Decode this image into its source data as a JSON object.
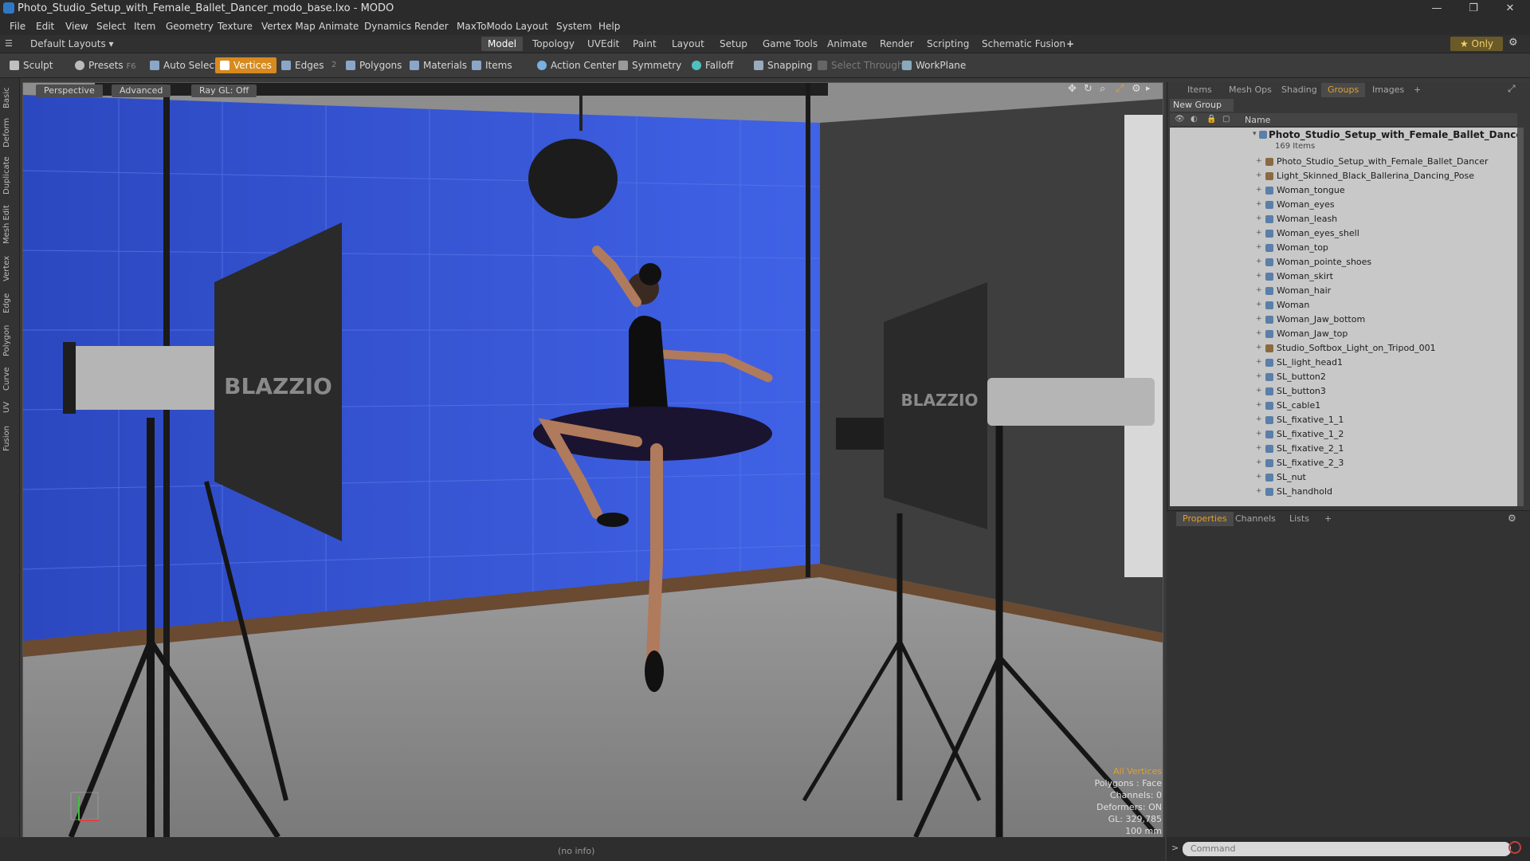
{
  "window": {
    "title": "Photo_Studio_Setup_with_Female_Ballet_Dancer_modo_base.lxo - MODO"
  },
  "menu": [
    "File",
    "Edit",
    "View",
    "Select",
    "Item",
    "Geometry",
    "Texture",
    "Vertex Map",
    "Animate",
    "Dynamics",
    "Render",
    "MaxToModo",
    "Layout",
    "System",
    "Help"
  ],
  "layout_bar": {
    "preset": "Default Layouts ▾",
    "tabs": [
      "Model",
      "Topology",
      "UVEdit",
      "Paint",
      "Layout",
      "Setup",
      "Game Tools",
      "Animate",
      "Render",
      "Scripting",
      "Schematic Fusion"
    ],
    "active_tab": "Model",
    "only_label": "★ Only"
  },
  "toolbar": {
    "sculpt": "Sculpt",
    "presets": "Presets",
    "presets_key": "F6",
    "auto_select": "Auto Select",
    "vertices": "Vertices",
    "edges": "Edges",
    "edges_count": "2",
    "polygons": "Polygons",
    "materials": "Materials",
    "items": "Items",
    "action_center": "Action Center",
    "symmetry": "Symmetry",
    "falloff": "Falloff",
    "snapping": "Snapping",
    "select_through": "Select Through",
    "workplane": "WorkPlane"
  },
  "left_tabs": [
    "Basic",
    "Deform",
    "Duplicate",
    "Mesh Edit",
    "Vertex",
    "Edge",
    "Polygon",
    "Curve",
    "UV",
    "Fusion"
  ],
  "viewport": {
    "tabs": [
      "Perspective",
      "Advanced",
      "Ray GL: Off"
    ],
    "softbox_brand": "BLAZZIO",
    "readout": {
      "mode": "All Vertices",
      "polygons": "Polygons : Face",
      "channels": "Channels: 0",
      "deformers": "Deformers: ON",
      "gl": "GL: 329,785",
      "scale": "100 mm"
    }
  },
  "status": {
    "info": "(no info)"
  },
  "right_panel": {
    "tabs": [
      "Items",
      "Mesh Ops",
      "Shading",
      "Groups",
      "Images",
      "+"
    ],
    "active_tab": "Groups",
    "new_group": "New Group",
    "name_header": "Name",
    "group_name": "Photo_Studio_Setup_with_Female_Ballet_Dancer",
    "group_count": "169 Items",
    "items": [
      "Photo_Studio_Setup_with_Female_Ballet_Dancer",
      "Light_Skinned_Black_Ballerina_Dancing_Pose",
      "Woman_tongue",
      "Woman_eyes",
      "Woman_leash",
      "Woman_eyes_shell",
      "Woman_top",
      "Woman_pointe_shoes",
      "Woman_skirt",
      "Woman_hair",
      "Woman",
      "Woman_Jaw_bottom",
      "Woman_Jaw_top",
      "Studio_Softbox_Light_on_Tripod_001",
      "SL_light_head1",
      "SL_button2",
      "SL_button3",
      "SL_cable1",
      "SL_fixative_1_1",
      "SL_fixative_1_2",
      "SL_fixative_2_1",
      "SL_fixative_2_3",
      "SL_nut",
      "SL_handhold"
    ],
    "lower_tabs": [
      "Properties",
      "Channels",
      "Lists",
      "+"
    ],
    "lower_active": "Properties",
    "command_placeholder": "Command"
  }
}
